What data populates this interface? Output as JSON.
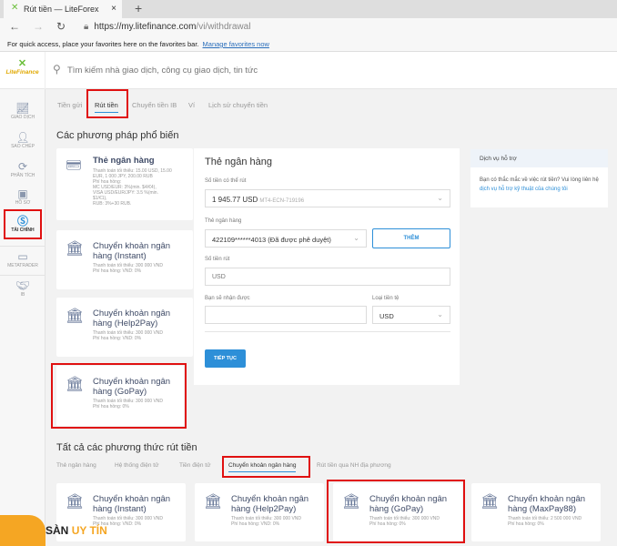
{
  "browser": {
    "tab_title": "Rút tiền — LiteForex",
    "url_host": "https://my.litefinance.com",
    "url_path": "/vi/withdrawal",
    "favbar_text": "For quick access, place your favorites here on the favorites bar.",
    "favbar_link": "Manage favorites now"
  },
  "header": {
    "logo": "LiteFinance",
    "search_placeholder": "Tìm kiếm nhà giao dịch, công cụ giao dịch, tin tức"
  },
  "sidebar": {
    "items": [
      {
        "label": "GIAO DỊCH",
        "icon": "chart-icon"
      },
      {
        "label": "SAO CHÉP",
        "icon": "user-icon"
      },
      {
        "label": "PHÂN TÍCH",
        "icon": "analysis-icon"
      },
      {
        "label": "HỒ SƠ",
        "icon": "profile-icon"
      },
      {
        "label": "TÀI CHÍNH",
        "icon": "dollar-icon"
      },
      {
        "label": "METATRADER",
        "icon": "window-icon"
      },
      {
        "label": "IB",
        "icon": "handshake-icon"
      }
    ]
  },
  "tabs": [
    "Tiền gửi",
    "Rút tiền",
    "Chuyển tiền IB",
    "Ví",
    "Lịch sử chuyển tiền"
  ],
  "popular": {
    "title": "Các phương pháp phổ biến",
    "cards": [
      {
        "title": "Thẻ ngân hàng",
        "lines": [
          "Thanh toán tối thiểu: 15.00 USD, 15.00",
          "EUR, 1 000 JPY, 200.00 RUB",
          "Phí hoa hồng:",
          "MC USD/EUR: 3%(min. $4/€4),",
          "VISA USD/EUR/JPY: 3.5 %(min.",
          "$1/€1),",
          "RUB: 3%+30 RUB."
        ]
      },
      {
        "title1": "Chuyển khoản ngân",
        "title2": "hàng (Instant)",
        "lines": [
          "Thanh toán tối thiểu: 300 000 VND",
          "Phí hoa hồng: VND: 0%"
        ]
      },
      {
        "title1": "Chuyển khoản ngân",
        "title2": "hàng (Help2Pay)",
        "lines": [
          "Thanh toán tối thiểu: 300 000 VND",
          "Phí hoa hồng: VND: 0%"
        ]
      },
      {
        "title1": "Chuyển khoản ngân",
        "title2": "hàng (GoPay)",
        "lines": [
          "Thanh toán tối thiểu: 300 000 VND",
          "Phí hoa hồng: 0%"
        ]
      }
    ]
  },
  "form": {
    "title": "Thẻ ngân hàng",
    "available_label": "Số tiền có thể rút",
    "available_value": "1 945.77 USD",
    "account": "MT4-ECN-719196",
    "card_label": "Thẻ ngân hàng",
    "card_value": "422109******4013 (Đã được phê duyệt)",
    "add_button": "THÊM",
    "amount_label": "Số tiền rút",
    "amount_placeholder": "USD",
    "receive_label": "Bạn sẽ nhận được",
    "currency_label": "Loại tiền tệ",
    "currency_value": "USD",
    "continue_button": "TIẾP TỤC"
  },
  "support": {
    "title": "Dịch vụ hỗ trợ",
    "text": "Bạn có thắc mắc về việc rút tiền? Vui lòng liên hệ",
    "link": "dịch vụ hỗ trợ kỹ thuật của chúng tôi"
  },
  "all": {
    "title": "Tất cả các phương thức rút tiền",
    "tabs": [
      "Thẻ ngân hàng",
      "Hệ thống điện tử",
      "Tiền điện tử",
      "Chuyển khoản ngân hàng",
      "Rút tiền qua NH địa phương"
    ],
    "cards": [
      {
        "title1": "Chuyển khoản ngân",
        "title2": "hàng (Instant)",
        "lines": [
          "Thanh toán tối thiểu: 300 000 VND",
          "Phí hoa hồng: VND: 0%"
        ]
      },
      {
        "title1": "Chuyển khoản ngân",
        "title2": "hàng (Help2Pay)",
        "lines": [
          "Thanh toán tối thiểu: 300 000 VND",
          "Phí hoa hồng: VND: 0%"
        ]
      },
      {
        "title1": "Chuyển khoản ngân",
        "title2": "hàng (GoPay)",
        "lines": [
          "Thanh toán tối thiểu: 300 000 VND",
          "Phí hoa hồng: 0%"
        ]
      },
      {
        "title1": "Chuyển khoản ngân",
        "title2": "hàng (MaxPay88)",
        "lines": [
          "Thanh toán tối thiểu: 2 500 000 VND",
          "Phí hoa hồng: 0%"
        ]
      }
    ]
  },
  "watermark": {
    "text1": "SÀN",
    "text2": "UY TÍN"
  },
  "colors": {
    "accent": "#2d8fd8",
    "highlight": "#e01010",
    "brand_green": "#6bbf3a"
  }
}
